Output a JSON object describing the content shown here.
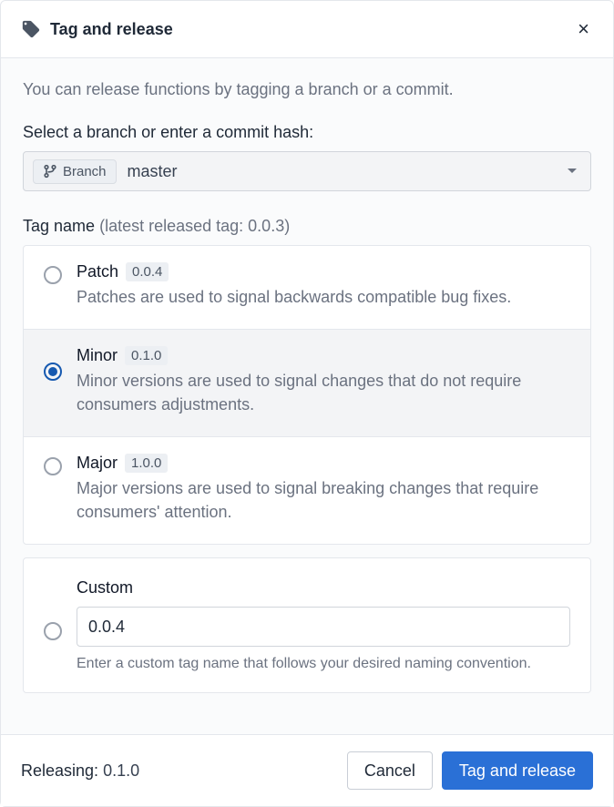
{
  "header": {
    "title": "Tag and release"
  },
  "intro": "You can release functions by tagging a branch or a commit.",
  "branch_section": {
    "label": "Select a branch or enter a commit hash:",
    "badge_label": "Branch",
    "selected": "master"
  },
  "tag_section": {
    "label": "Tag name",
    "hint": "(latest released tag: 0.0.3)"
  },
  "options": {
    "patch": {
      "title": "Patch",
      "version": "0.0.4",
      "desc": "Patches are used to signal backwards compatible bug fixes."
    },
    "minor": {
      "title": "Minor",
      "version": "0.1.0",
      "desc": "Minor versions are used to signal changes that do not require consumers adjustments."
    },
    "major": {
      "title": "Major",
      "version": "1.0.0",
      "desc": "Major versions are used to signal breaking changes that require consumers' attention."
    }
  },
  "custom": {
    "title": "Custom",
    "value": "0.0.4",
    "hint": "Enter a custom tag name that follows your desired naming convention."
  },
  "footer": {
    "releasing_label": "Releasing:",
    "releasing_value": "0.1.0",
    "cancel": "Cancel",
    "submit": "Tag and release"
  },
  "selected_option": "minor"
}
